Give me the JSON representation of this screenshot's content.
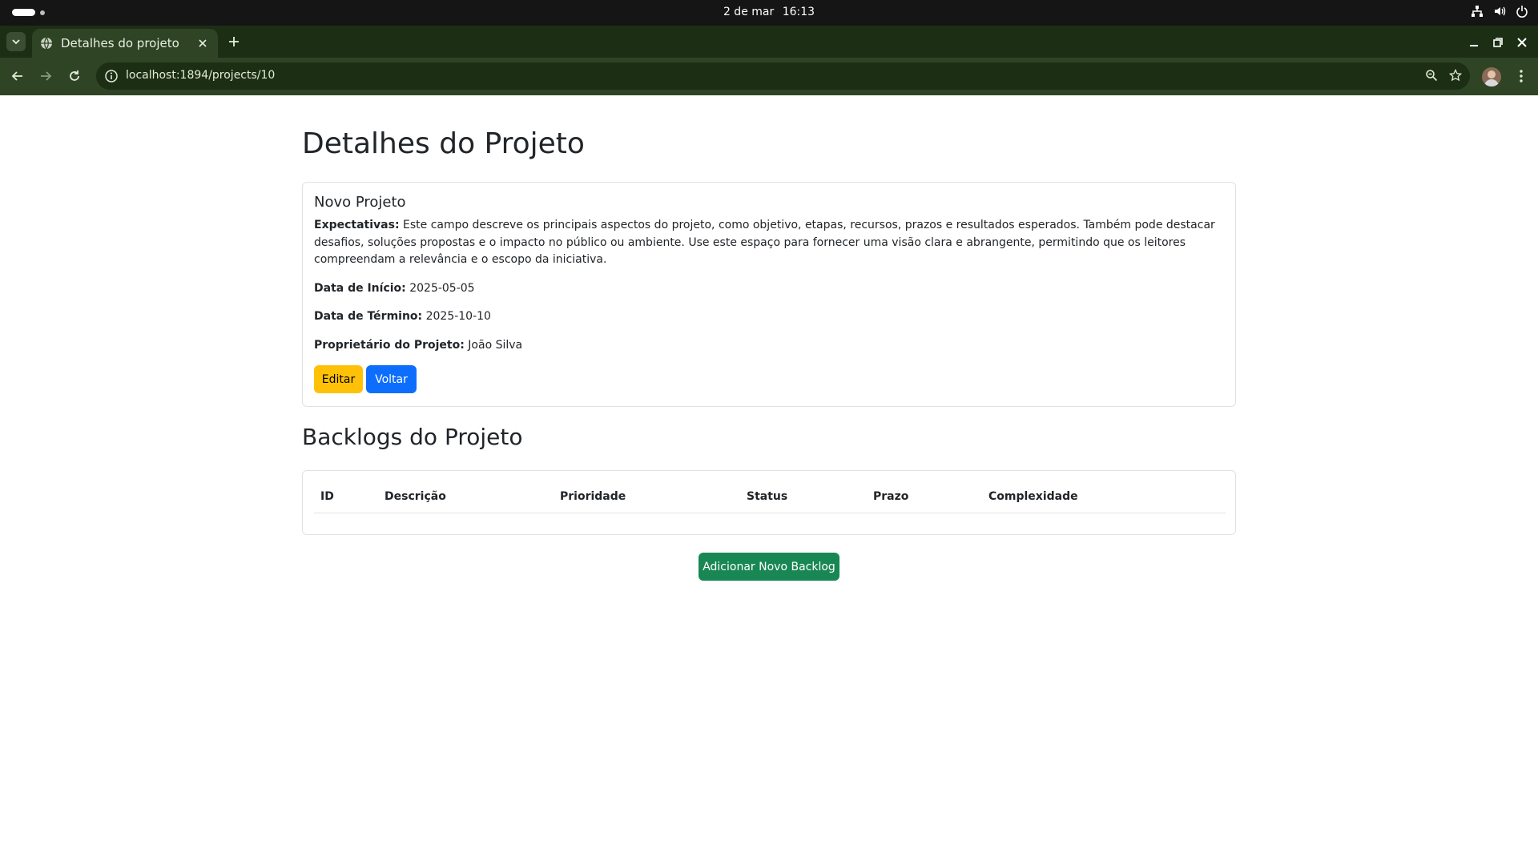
{
  "system": {
    "date": "2 de mar",
    "time": "16:13"
  },
  "browser": {
    "tab_title": "Detalhes do projeto",
    "url": "localhost:1894/projects/10"
  },
  "page": {
    "title": "Detalhes do Projeto",
    "project": {
      "name": "Novo Projeto",
      "expectations_label": "Expectativas:",
      "expectations_value": "Este campo descreve os principais aspectos do projeto, como objetivo, etapas, recursos, prazos e resultados esperados. Também pode destacar desafios, soluções propostas e o impacto no público ou ambiente. Use este espaço para fornecer uma visão clara e abrangente, permitindo que os leitores compreendam a relevância e o escopo da iniciativa.",
      "start_label": "Data de Início:",
      "start_value": "2025-05-05",
      "end_label": "Data de Término:",
      "end_value": "2025-10-10",
      "owner_label": "Proprietário do Projeto:",
      "owner_value": "João Silva",
      "edit_label": "Editar",
      "back_label": "Voltar"
    },
    "backlogs": {
      "title": "Backlogs do Projeto",
      "columns": [
        "ID",
        "Descrição",
        "Prioridade",
        "Status",
        "Prazo",
        "Complexidade"
      ],
      "rows": [],
      "add_label": "Adicionar Novo Backlog"
    }
  },
  "colors": {
    "warning": "#ffc107",
    "primary": "#0d6efd",
    "success": "#198754",
    "browser_frame": "#2e4424"
  }
}
